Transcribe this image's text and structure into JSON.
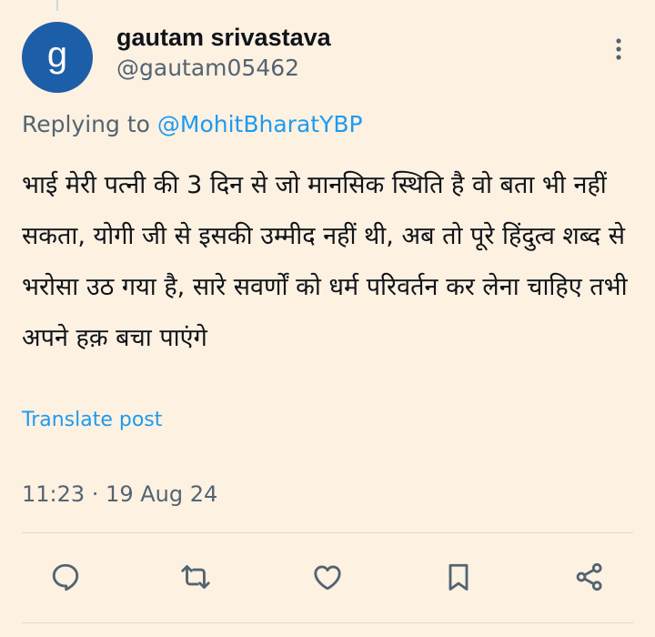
{
  "tweet": {
    "author": {
      "avatar_letter": "g",
      "avatar_color": "#1d5ea8",
      "display_name": "gautam srivastava",
      "handle": "@gautam05462"
    },
    "reply_prefix": "Replying to ",
    "reply_mention": "@MohitBharatYBP",
    "text": "भाई मेरी पत्नी की 3 दिन से जो मानसिक स्थिति है वो बता भी नहीं सकता, योगी जी से इसकी उम्मीद नहीं थी, अब तो पूरे हिंदुत्व शब्द से भरोसा उठ गया है, सारे सवर्णों को धर्म परिवर्तन कर लेना चाहिए तभी अपने हक़ बचा पाएंगे",
    "translate_label": "Translate post",
    "timestamp": "11:23 · 19 Aug 24"
  },
  "actions": [
    {
      "name": "reply",
      "icon": "speech-bubble-icon"
    },
    {
      "name": "repost",
      "icon": "repost-arrows-icon"
    },
    {
      "name": "like",
      "icon": "heart-icon"
    },
    {
      "name": "bookmark",
      "icon": "bookmark-icon"
    },
    {
      "name": "share",
      "icon": "share-nodes-icon"
    }
  ],
  "colors": {
    "background": "#fdf1e2",
    "accent": "#1d9bf0",
    "secondary_text": "#536471",
    "primary_text": "#0f1419"
  }
}
